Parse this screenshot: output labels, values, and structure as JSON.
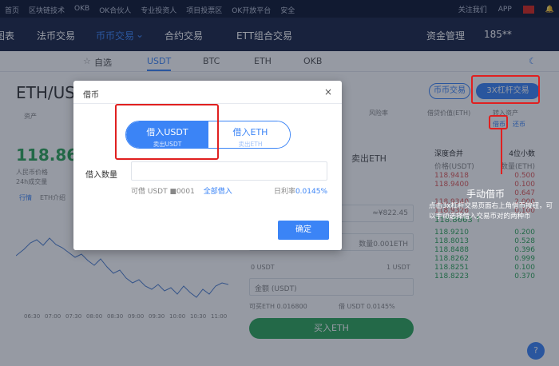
{
  "topbar": {
    "links": [
      "首页",
      "区块链技术",
      "OKB",
      "OK合伙人",
      "专业投资人",
      "项目投票区",
      "OK开放平台",
      "安全"
    ],
    "right": [
      "关注我们",
      "APP"
    ]
  },
  "nav": {
    "items": [
      "图表",
      "法币交易",
      "币币交易",
      "合约交易",
      "ETT组合交易"
    ],
    "active_index": 2,
    "right": [
      "资金管理",
      "185**"
    ]
  },
  "subnav": {
    "items": [
      "自选",
      "USDT",
      "BTC",
      "ETH",
      "OKB"
    ],
    "active": "USDT"
  },
  "page": {
    "pair": "ETH/US",
    "tab_spot": "币币交易",
    "tab_margin": "3X杠杆交易",
    "labels": {
      "asset": "资产",
      "risk": "风险率",
      "borrowed": "借贷价值(ETH)",
      "transfer": "转入资产",
      "borrow": "借币",
      "repay": "还币"
    },
    "price": "118.866",
    "price_rmb": "人民币价格",
    "volume_24h": "24h成交量",
    "chart_tabs": [
      "行情",
      "ETH介绍"
    ],
    "sell_tab": "卖出ETH",
    "fields": {
      "price_rmb": "≈¥822.45",
      "amount": "数量0.001ETH",
      "total": "金额 (USDT)"
    },
    "available": "可买ETH 0.016800",
    "borrow_usdt": "借 USDT 0.0145%",
    "usdt_left": "0 USDT",
    "usdt_right": "1 USDT",
    "buy_button": "买入ETH",
    "book_title": "深度合并",
    "book_decimals": "4位小数",
    "book_cols": [
      "价格(USDT)",
      "数量(ETH)"
    ],
    "asks": [
      {
        "p": "118.9418",
        "q": "0.500"
      },
      {
        "p": "118.9400",
        "q": "0.100"
      },
      {
        "p": "118.9340",
        "q": "2.000"
      },
      {
        "p": "118.9326",
        "q": "0.100"
      }
    ],
    "ask_right_extra": "0.647",
    "last_price": "118.8663",
    "bids": [
      {
        "p": "118.9210",
        "q": "0.200"
      },
      {
        "p": "118.8013",
        "q": "0.528"
      },
      {
        "p": "118.8488",
        "q": "0.396"
      },
      {
        "p": "118.8262",
        "q": "0.999"
      },
      {
        "p": "118.8251",
        "q": "0.100"
      },
      {
        "p": "118.8223",
        "q": "0.370"
      }
    ],
    "x_ticks": [
      "06:30",
      "07:00",
      "07:30",
      "08:00",
      "08:30",
      "09:00",
      "09:30",
      "10:00",
      "10:30",
      "11:00"
    ]
  },
  "modal": {
    "title": "借币",
    "close": "×",
    "option1_title": "借入USDT",
    "option1_sub": "卖出USDT",
    "option2_title": "借入ETH",
    "option2_sub": "卖出ETH",
    "amount_label": "借入数量",
    "available_label": "可借  USDT ■0001",
    "borrow_all": "全部借入",
    "rate_label": "日利率",
    "rate_value": "0.0145%",
    "confirm": "确定"
  },
  "annotation": {
    "title": "手动借币",
    "text": "点击3x杠杆交易页面右上角借币按钮，可以手动选择借入交易币对的两种币"
  },
  "colors": {
    "accent": "#3b84f6",
    "up": "#2fa65a",
    "annotation": "#e02020"
  }
}
